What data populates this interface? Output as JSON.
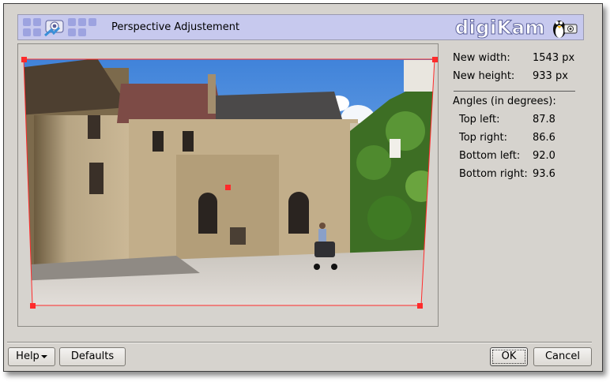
{
  "window": {
    "title": "Perspective Adjustement",
    "brand": "digiKam"
  },
  "info": {
    "new_width_label": "New width:",
    "new_width_value": "1543 px",
    "new_height_label": "New height:",
    "new_height_value": "933 px",
    "angles_heading": "Angles (in degrees):",
    "angles": [
      {
        "label": "Top left:",
        "value": "87.8"
      },
      {
        "label": "Top right:",
        "value": "86.6"
      },
      {
        "label": "Bottom left:",
        "value": "92.0"
      },
      {
        "label": "Bottom right:",
        "value": "93.6"
      }
    ]
  },
  "buttons": {
    "help_label": "Help",
    "defaults_label": "Defaults",
    "ok_label": "OK",
    "cancel_label": "Cancel"
  },
  "preview": {
    "image_name": "courtyard-photo",
    "frame_color": "#ff2b2b"
  }
}
